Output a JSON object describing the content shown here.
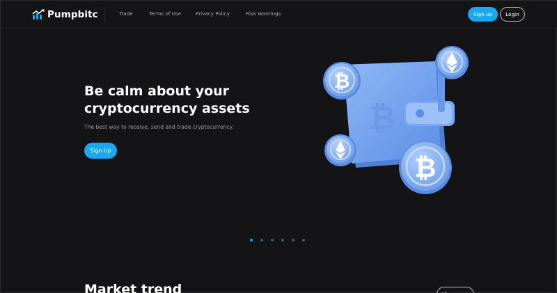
{
  "brand": {
    "name": "Pumpbitc",
    "accent": "#1da7f0"
  },
  "nav": {
    "items": [
      {
        "label": "Trade"
      },
      {
        "label": "Terms of Use"
      },
      {
        "label": "Privacy Policy"
      },
      {
        "label": "Risk Warnings"
      }
    ],
    "signup_label": "Sign up",
    "login_label": "Login"
  },
  "hero": {
    "title_line1": "Be calm about your",
    "title_line2": "cryptocurrency assets",
    "subtitle": "The best way to receive, send and trade cryptocurrency.",
    "cta_label": "Sign Up",
    "image_icon": "bitcoin-wallet-illustration"
  },
  "carousel": {
    "count": 6,
    "active_index": 0
  },
  "market": {
    "title": "Market trend",
    "view_more_label": "View more"
  }
}
